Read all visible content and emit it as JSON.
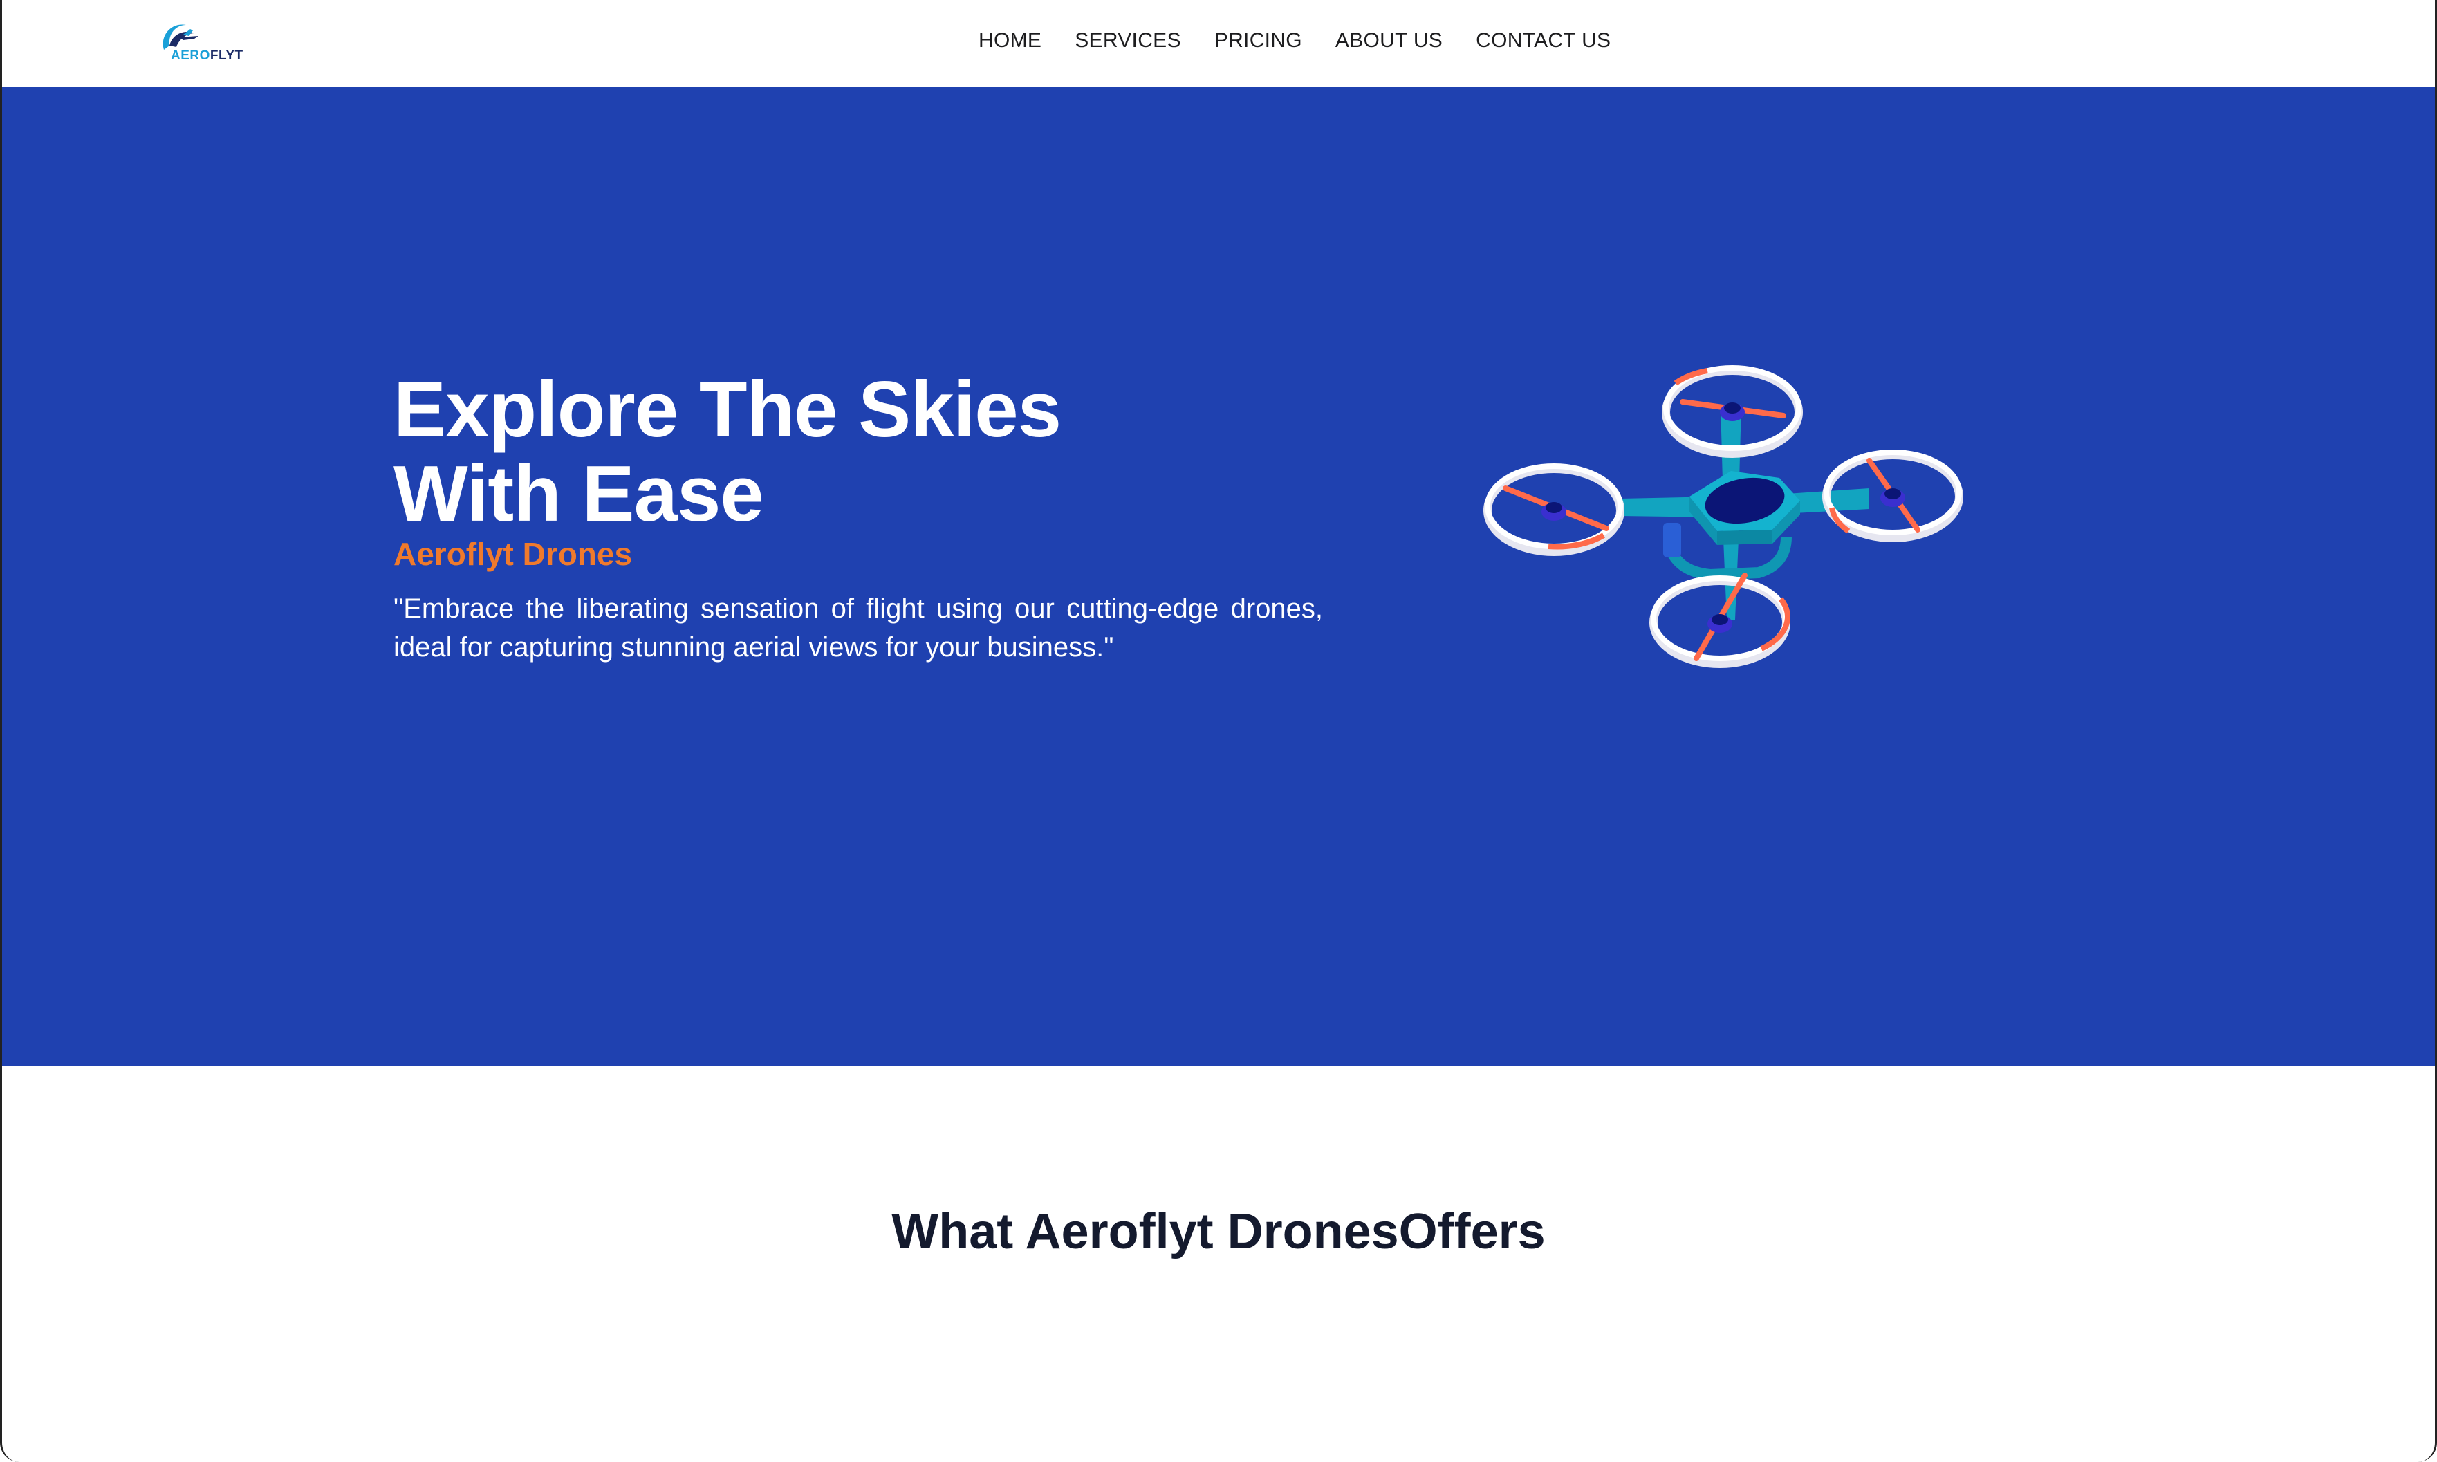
{
  "nav": {
    "logo_text_a": "AERO",
    "logo_text_b": "FLYT",
    "links": [
      "HOME",
      "SERVICES",
      "PRICING",
      "ABOUT US",
      "CONTACT US"
    ]
  },
  "hero": {
    "title_line1": "Explore The Skies",
    "title_line2": "With Ease",
    "subtitle": "Aeroflyt Drones",
    "description": "\"Embrace the liberating sensation of flight using our cutting-edge drones, ideal for capturing stunning aerial views for your business.\"",
    "illustration": "drone-illustration"
  },
  "offers": {
    "title": "What Aeroflyt DronesOffers"
  },
  "colors": {
    "hero_bg": "#1f41b0",
    "accent_orange": "#f07a2c",
    "drone_teal": "#14b3cf",
    "drone_navy": "#0b1576",
    "heading_dark": "#141a2e"
  }
}
